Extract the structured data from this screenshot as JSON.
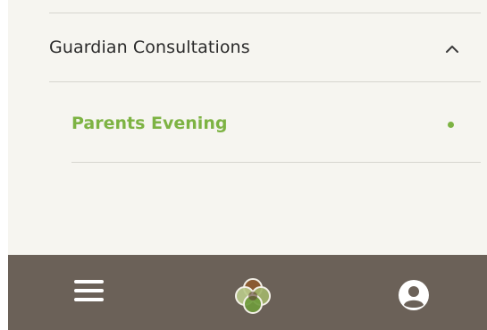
{
  "menu": {
    "section": {
      "title": "Guardian Consultations",
      "expanded": true,
      "chevron_icon": "chevron-up-icon"
    },
    "items": [
      {
        "label": "Parents Evening",
        "active": true
      }
    ]
  },
  "bottom_nav": {
    "menu_icon": "hamburger-menu-icon",
    "logo_icon": "four-petal-logo-icon",
    "profile_icon": "user-account-icon"
  },
  "colors": {
    "panel_background": "#f6f5f0",
    "bottom_bar": "#6b6158",
    "accent_green": "#7db343",
    "divider": "#d7d5cf",
    "text": "#2b2b2b"
  }
}
